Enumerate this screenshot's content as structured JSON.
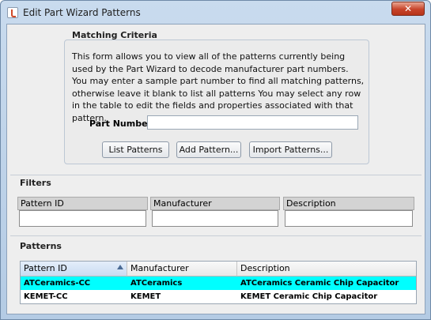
{
  "window": {
    "title": "Edit Part Wizard Patterns",
    "close_glyph": "✕"
  },
  "matching": {
    "title": "Matching Criteria",
    "description": "This form allows you to view all of the patterns currently being used by the Part Wizard to decode manufacturer part numbers. You may enter a sample part number to find all matching patterns, otherwise leave it blank to list all patterns You may select any row in the table to edit the fields and properties associated with that pattern.",
    "part_number_label": "Part Number:",
    "part_number_value": "",
    "buttons": {
      "list": "List Patterns",
      "add": "Add Pattern...",
      "import": "Import Patterns..."
    }
  },
  "filters": {
    "title": "Filters",
    "columns": [
      "Pattern ID",
      "Manufacturer",
      "Description"
    ],
    "values": [
      "",
      "",
      ""
    ]
  },
  "patterns": {
    "title": "Patterns",
    "columns": [
      "Pattern ID",
      "Manufacturer",
      "Description"
    ],
    "sorted_column": "Pattern ID",
    "selected_row": 0,
    "rows": [
      [
        "ATCeramics-CC",
        "ATCeramics",
        "ATCeramics Ceramic Chip Capacitor"
      ],
      [
        "KEMET-CC",
        "KEMET",
        "KEMET Ceramic Chip Capacitor"
      ]
    ]
  },
  "colors": {
    "selection": "#00ffff",
    "titlebar": "#c9dbee",
    "close": "#c7442a"
  }
}
